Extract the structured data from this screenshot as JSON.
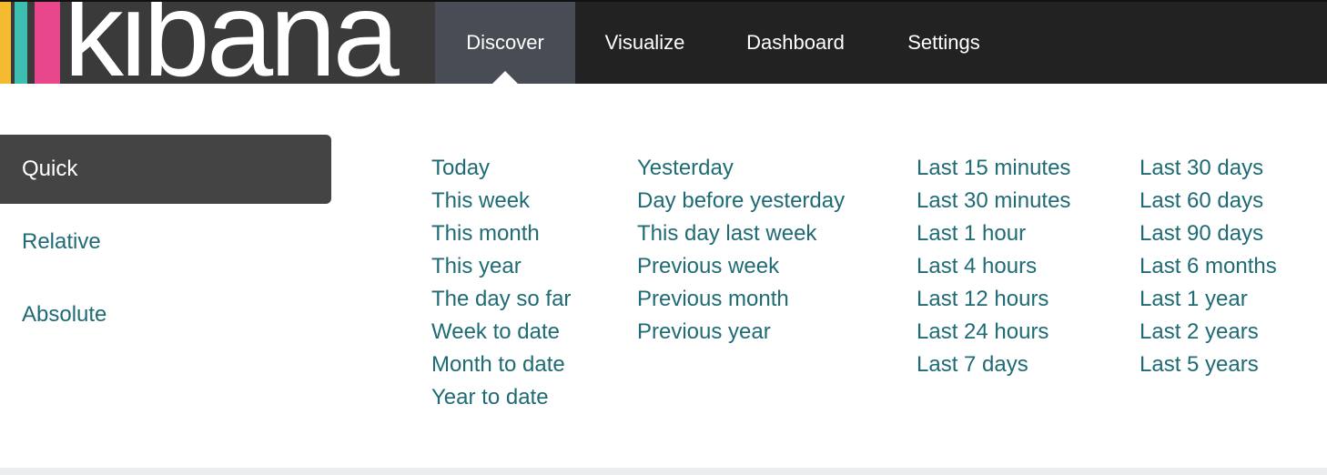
{
  "header": {
    "logo_text": "kibana",
    "logo_stripe_colors": [
      "#F4BB30",
      "#3EBEB0",
      "#E8488B"
    ],
    "nav": [
      {
        "label": "Discover",
        "active": true
      },
      {
        "label": "Visualize",
        "active": false
      },
      {
        "label": "Dashboard",
        "active": false
      },
      {
        "label": "Settings",
        "active": false
      }
    ]
  },
  "time_picker": {
    "modes": [
      {
        "label": "Quick",
        "active": true
      },
      {
        "label": "Relative",
        "active": false
      },
      {
        "label": "Absolute",
        "active": false
      }
    ],
    "quick_columns": [
      [
        "Today",
        "This week",
        "This month",
        "This year",
        "The day so far",
        "Week to date",
        "Month to date",
        "Year to date"
      ],
      [
        "Yesterday",
        "Day before yesterday",
        "This day last week",
        "Previous week",
        "Previous month",
        "Previous year"
      ],
      [
        "Last 15 minutes",
        "Last 30 minutes",
        "Last 1 hour",
        "Last 4 hours",
        "Last 12 hours",
        "Last 24 hours",
        "Last 7 days"
      ],
      [
        "Last 30 days",
        "Last 60 days",
        "Last 90 days",
        "Last 6 months",
        "Last 1 year",
        "Last 2 years",
        "Last 5 years"
      ]
    ]
  },
  "colors": {
    "link": "#1F6B75",
    "active_tab_bg": "#444444",
    "topbar_bg": "#222222",
    "active_nav_bg": "#484C54"
  }
}
